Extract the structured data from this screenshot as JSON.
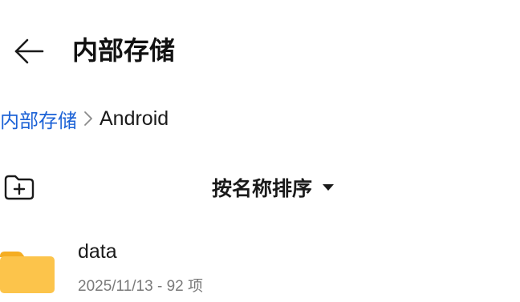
{
  "header": {
    "title": "内部存储",
    "back_icon": "arrow-left-icon"
  },
  "breadcrumb": {
    "items": [
      {
        "label": "内部存储",
        "link": true
      },
      {
        "label": "Android",
        "link": false
      }
    ],
    "separator_icon": "chevron-right-icon"
  },
  "toolbar": {
    "new_folder_icon": "new-folder-icon",
    "sort_label": "按名称排序",
    "sort_caret_icon": "caret-down-icon"
  },
  "files": [
    {
      "name": "data",
      "date": "2025/11/13",
      "separator": " - ",
      "count": "92 项",
      "icon": "folder-icon"
    }
  ],
  "colors": {
    "accent": "#1c62d6",
    "folder": "#fcc44b",
    "folder_tab": "#f5ad22",
    "meta_text": "#7a7a7a"
  }
}
